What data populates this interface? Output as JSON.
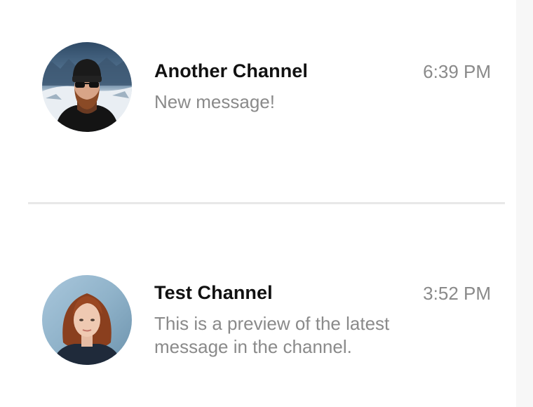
{
  "channels": [
    {
      "name": "Another Channel",
      "time": "6:39 PM",
      "preview": "New message!",
      "avatar": "man-beanie-sunglasses-snow"
    },
    {
      "name": "Test Channel",
      "time": "3:52 PM",
      "preview": "This is a preview of the latest message in the channel.",
      "avatar": "woman-auburn-hair"
    }
  ],
  "colors": {
    "name": "#111111",
    "secondary_text": "#8a8a8a",
    "divider": "#e8e8e8",
    "background": "#ffffff"
  }
}
